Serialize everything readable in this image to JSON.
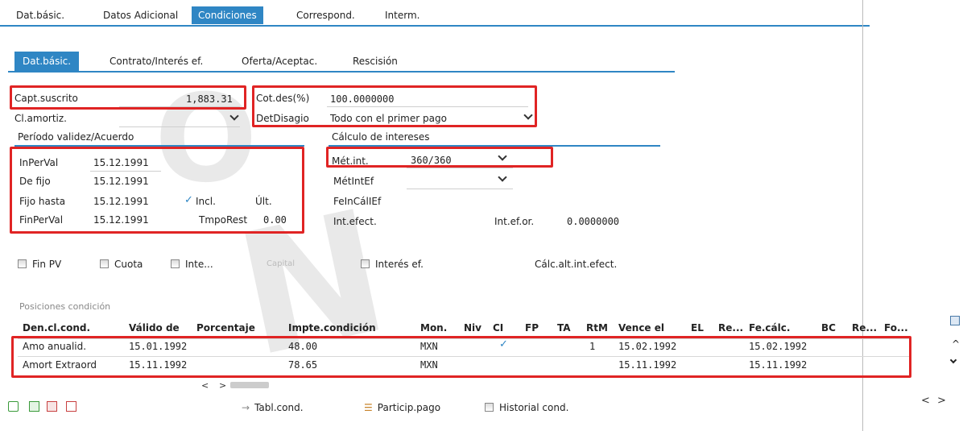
{
  "tabs_top": [
    "Dat.básic.",
    "Datos Adicional",
    "Condiciones",
    "Correspond.",
    "Interm."
  ],
  "tabs_sub": [
    "Dat.básic.",
    "Contrato/Interés ef.",
    "Oferta/Aceptac.",
    "Rescisión"
  ],
  "left": {
    "capt_label": "Capt.suscrito",
    "capt_value": "1,883.31",
    "clamortiz_label": "Cl.amortiz.",
    "section_title": "Período validez/Acuerdo",
    "rows": [
      {
        "label": "InPerVal",
        "value": "15.12.1991"
      },
      {
        "label": "De fijo",
        "value": "15.12.1991"
      },
      {
        "label": "Fijo hasta",
        "value": "15.12.1991"
      },
      {
        "label": "FinPerVal",
        "value": "15.12.1991"
      }
    ],
    "incl_label": "Incl.",
    "ult_label": "Últ.",
    "tmporest_label": "TmpoRest",
    "tmporest_value": "0.00"
  },
  "right": {
    "cotdes_label": "Cot.des(%)",
    "cotdes_value": "100.0000000",
    "detdisagio_label": "DetDisagio",
    "detdisagio_value": "Todo con el primer pago",
    "section_title": "Cálculo de intereses",
    "metint_label": "Mét.int.",
    "metint_value": "360/360",
    "metintef_label": "MétIntEf",
    "feincallef_label": "FeInCálIEf",
    "intefect_label": "Int.efect.",
    "intefor_label": "Int.ef.or.",
    "intefor_value": "0.0000000"
  },
  "buttons": {
    "finpv": "Fin PV",
    "cuota": "Cuota",
    "inte": "Inte...",
    "capital": "Capital",
    "interesef": "Interés ef.",
    "calc": "Cálc.alt.int.efect."
  },
  "table": {
    "title": "Posiciones condición",
    "headers": [
      "Den.cl.cond.",
      "Válido de",
      "Porcentaje",
      "Impte.condición",
      "Mon.",
      "Niv",
      "CI",
      "FP",
      "TA",
      "RtM",
      "Vence el",
      "EL",
      "Re...",
      "Fe.cálc.",
      "BC",
      "Re...",
      "Fo..."
    ],
    "rows": [
      {
        "den": "Amo anualid.",
        "valido": "15.01.1992",
        "importe": "48.00",
        "mon": "MXN",
        "rtm": "1",
        "vence": "15.02.1992",
        "fecalc": "15.02.1992"
      },
      {
        "den": "Amort Extraord",
        "valido": "15.11.1992",
        "importe": "78.65",
        "mon": "MXN",
        "rtm": "",
        "vence": "15.11.1992",
        "fecalc": "15.11.1992"
      }
    ]
  },
  "bottom": {
    "tabl": "Tabl.cond.",
    "particip": "Particip.pago",
    "historial": "Historial cond."
  },
  "colors": {
    "accent": "#2f86c4",
    "highlight": "#e02424"
  }
}
